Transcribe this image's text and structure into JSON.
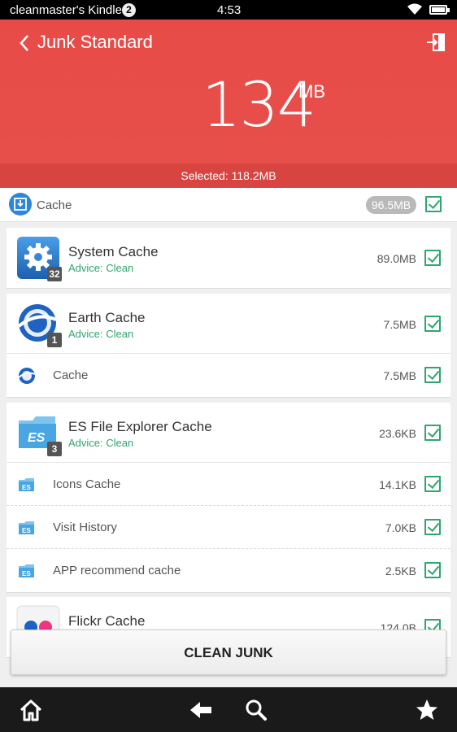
{
  "status_bar": {
    "device_name": "cleanmaster's Kindle",
    "notification_count": "2",
    "time": "4:53"
  },
  "header": {
    "title": "Junk Standard",
    "total_size": "134",
    "total_unit": "MB",
    "selected_text": "Selected: 118.2MB",
    "background_color": "#e84b47"
  },
  "category": {
    "label": "Cache",
    "size": "96.5MB",
    "checked": true
  },
  "items": [
    {
      "name": "System Cache",
      "advice": "Advice: Clean",
      "size": "89.0MB",
      "count": "32",
      "icon": "system-gear-icon",
      "checked": true,
      "subs": []
    },
    {
      "name": "Earth Cache",
      "advice": "Advice: Clean",
      "size": "7.5MB",
      "count": "1",
      "icon": "google-earth-icon",
      "checked": true,
      "subs": [
        {
          "label": "Cache",
          "size": "7.5MB",
          "icon": "google-earth-icon",
          "checked": true
        }
      ]
    },
    {
      "name": "ES File Explorer Cache",
      "advice": "Advice: Clean",
      "size": "23.6KB",
      "count": "3",
      "icon": "es-folder-icon",
      "checked": true,
      "subs": [
        {
          "label": "Icons Cache",
          "size": "14.1KB",
          "icon": "es-folder-icon",
          "checked": true
        },
        {
          "label": "Visit History",
          "size": "7.0KB",
          "icon": "es-folder-icon",
          "checked": true
        },
        {
          "label": "APP recommend cache",
          "size": "2.5KB",
          "icon": "es-folder-icon",
          "checked": true
        }
      ]
    },
    {
      "name": "Flickr Cache",
      "advice": "",
      "size": "124.0B",
      "count": "",
      "icon": "flickr-icon",
      "checked": true,
      "subs": []
    }
  ],
  "clean_button": {
    "label": "CLEAN JUNK"
  },
  "accent_color": "#2ea66e"
}
